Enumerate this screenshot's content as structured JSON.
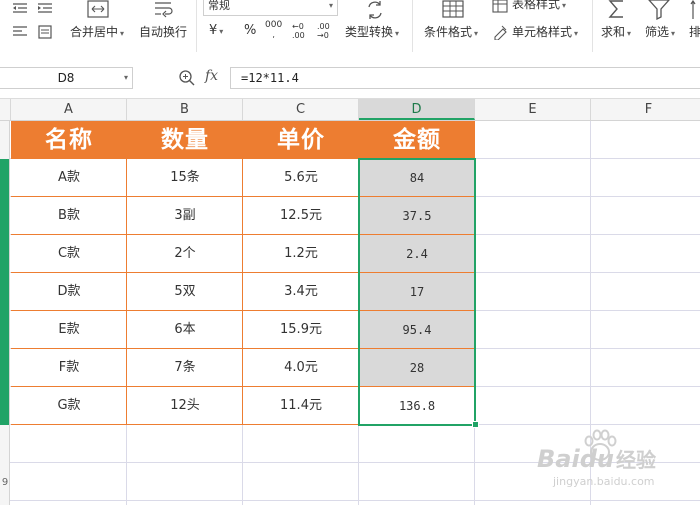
{
  "ribbon": {
    "merge_center": "合并居中",
    "auto_wrap": "自动换行",
    "number_format": "常规",
    "currency": "¥",
    "percent": "%",
    "thousands": "000",
    "inc_decimal": "+.0 .00",
    "dec_decimal": ".00 →.0",
    "type_convert": "类型转换",
    "cond_format": "条件格式",
    "table_style": "表格样式",
    "cell_style": "单元格样式",
    "sum": "求和",
    "filter": "筛选",
    "sort": "排"
  },
  "formula_bar": {
    "cell_ref": "D8",
    "fx": "fx",
    "formula": "=12*11.4"
  },
  "columns": [
    "A",
    "B",
    "C",
    "D",
    "E",
    "F"
  ],
  "selected_column": "D",
  "row_head_label": "9",
  "table": {
    "headers": [
      "名称",
      "数量",
      "单价",
      "金额"
    ],
    "rows": [
      [
        "A款",
        "15条",
        "5.6元",
        "84"
      ],
      [
        "B款",
        "3副",
        "12.5元",
        "37.5"
      ],
      [
        "C款",
        "2个",
        "1.2元",
        "2.4"
      ],
      [
        "D款",
        "5双",
        "3.4元",
        "17"
      ],
      [
        "E款",
        "6本",
        "15.9元",
        "95.4"
      ],
      [
        "F款",
        "7条",
        "4.0元",
        "28"
      ],
      [
        "G款",
        "12头",
        "11.4元",
        "136.8"
      ]
    ]
  },
  "watermark": {
    "brand": "Baidu",
    "sub": "经验",
    "url": "jingyan.baidu.com"
  },
  "colors": {
    "header_fill": "#ed7d31",
    "selection": "#21a366",
    "selected_fill": "#d9d9d9"
  }
}
